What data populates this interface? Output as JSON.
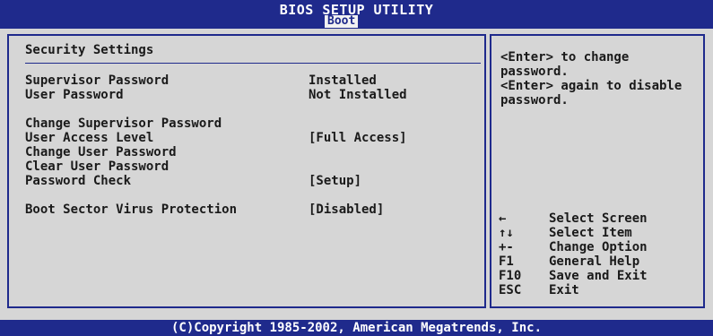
{
  "header": {
    "title": "BIOS SETUP UTILITY",
    "active_tab": "Boot"
  },
  "main": {
    "section_title": "Security Settings",
    "items": [
      {
        "label": "Supervisor Password",
        "value": "Installed"
      },
      {
        "label": "User Password",
        "value": "Not Installed"
      },
      {
        "label": "Change Supervisor Password",
        "value": ""
      },
      {
        "label": "User Access Level",
        "value": "[Full Access]"
      },
      {
        "label": "Change User Password",
        "value": ""
      },
      {
        "label": "Clear User Password",
        "value": ""
      },
      {
        "label": "Password Check",
        "value": "[Setup]"
      },
      {
        "label": "Boot Sector Virus Protection",
        "value": "[Disabled]"
      }
    ]
  },
  "help": {
    "text": "<Enter> to change password.\n<Enter> again to disable password.",
    "keys": [
      {
        "key": "←",
        "desc": "Select Screen",
        "icon": "arrow-left-icon"
      },
      {
        "key": "↑↓",
        "desc": "Select Item",
        "icon": "arrow-up-down-icon"
      },
      {
        "key": "+-",
        "desc": "Change Option"
      },
      {
        "key": "F1",
        "desc": "General Help"
      },
      {
        "key": "F10",
        "desc": "Save and Exit"
      },
      {
        "key": "ESC",
        "desc": "Exit"
      }
    ]
  },
  "footer": {
    "copyright": "(C)Copyright 1985-2002, American Megatrends, Inc."
  },
  "colors": {
    "background": "#d6d6d6",
    "frame_blue": "#1f2a8c",
    "text": "#1a1a1a",
    "header_text": "#ffffff"
  }
}
